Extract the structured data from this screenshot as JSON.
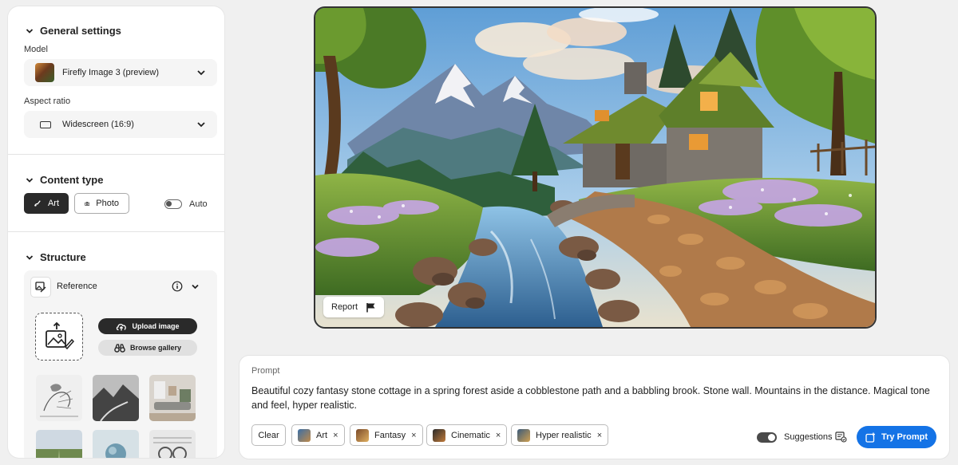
{
  "general_settings": {
    "title": "General settings",
    "model_label": "Model",
    "model_value": "Firefly Image 3 (preview)",
    "aspect_label": "Aspect ratio",
    "aspect_value": "Widescreen (16:9)"
  },
  "content_type": {
    "title": "Content type",
    "art_label": "Art",
    "photo_label": "Photo",
    "auto_label": "Auto",
    "selected": "Art"
  },
  "structure": {
    "title": "Structure",
    "reference_label": "Reference",
    "upload_label": "Upload image",
    "gallery_label": "Browse gallery"
  },
  "image": {
    "report_label": "Report"
  },
  "prompt": {
    "label": "Prompt",
    "text": "Beautiful cozy fantasy stone cottage in a spring forest aside a cobblestone path and a babbling brook. Stone wall. Mountains in the distance. Magical tone and feel, hyper realistic.",
    "clear_label": "Clear",
    "chips": [
      {
        "label": "Art",
        "close": "×"
      },
      {
        "label": "Fantasy",
        "close": "×"
      },
      {
        "label": "Cinematic",
        "close": "×"
      },
      {
        "label": "Hyper realistic",
        "close": "×"
      }
    ],
    "suggestions_label": "Suggestions",
    "try_label": "Try Prompt"
  },
  "colors": {
    "accent": "#1473e6",
    "dark_button": "#2a2a2a",
    "panel_bg": "#ffffff",
    "page_bg": "#f0f0f0"
  },
  "icons": [
    "chevron-down-icon",
    "aspect-rect-icon",
    "brush-icon",
    "camera-icon",
    "reference-icon",
    "info-icon",
    "image-upload-icon",
    "upload-cloud-icon",
    "binoculars-icon",
    "flag-icon",
    "suggestions-icon",
    "try-prompt-icon"
  ]
}
